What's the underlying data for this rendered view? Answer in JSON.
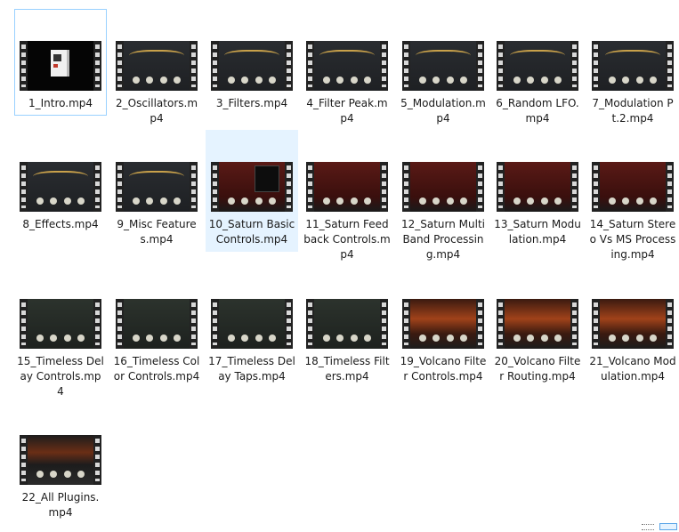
{
  "files": [
    {
      "name": "1_Intro.mp4",
      "style": "black",
      "state": "focused"
    },
    {
      "name": "2_Oscillators.mp4",
      "style": "dark",
      "state": ""
    },
    {
      "name": "3_Filters.mp4",
      "style": "dark",
      "state": ""
    },
    {
      "name": "4_Filter Peak.mp4",
      "style": "dark",
      "state": ""
    },
    {
      "name": "5_Modulation.mp4",
      "style": "dark",
      "state": ""
    },
    {
      "name": "6_Random LFO.mp4",
      "style": "dark",
      "state": ""
    },
    {
      "name": "7_Modulation Pt.2.mp4",
      "style": "dark",
      "state": ""
    },
    {
      "name": "8_Effects.mp4",
      "style": "dark",
      "state": ""
    },
    {
      "name": "9_Misc Features.mp4",
      "style": "dark",
      "state": ""
    },
    {
      "name": "10_Saturn Basic Controls.mp4",
      "style": "red",
      "state": "selected"
    },
    {
      "name": "11_Saturn Feedback Controls.mp4",
      "style": "red",
      "state": ""
    },
    {
      "name": "12_Saturn MultiBand Processing.mp4",
      "style": "red",
      "state": ""
    },
    {
      "name": "13_Saturn Modulation.mp4",
      "style": "red",
      "state": ""
    },
    {
      "name": "14_Saturn Stereo Vs MS Processing.mp4",
      "style": "red",
      "state": ""
    },
    {
      "name": "15_Timeless Delay Controls.mp4",
      "style": "green",
      "state": ""
    },
    {
      "name": "16_Timeless Color Controls.mp4",
      "style": "green",
      "state": ""
    },
    {
      "name": "17_Timeless Delay Taps.mp4",
      "style": "green",
      "state": ""
    },
    {
      "name": "18_Timeless Filters.mp4",
      "style": "green",
      "state": ""
    },
    {
      "name": "19_Volcano Filter Controls.mp4",
      "style": "orange",
      "state": ""
    },
    {
      "name": "20_Volcano Filter Routing.mp4",
      "style": "orange",
      "state": ""
    },
    {
      "name": "21_Volcano Modulation.mp4",
      "style": "orange",
      "state": ""
    },
    {
      "name": "22_All Plugins.mp4",
      "style": "mixed",
      "state": ""
    }
  ],
  "view_buttons": [
    {
      "name": "details-view-button",
      "kind": "details"
    },
    {
      "name": "large-icons-view-button",
      "kind": "icons"
    }
  ]
}
